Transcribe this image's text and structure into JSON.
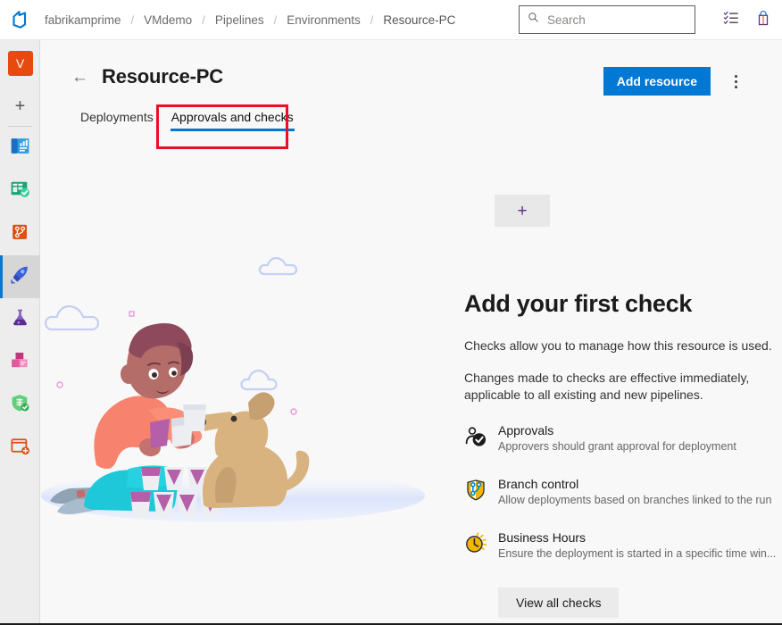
{
  "topbar": {
    "logo_icon": "azure-devops-logo",
    "breadcrumb": [
      "fabrikamprime",
      "VMdemo",
      "Pipelines",
      "Environments",
      "Resource-PC"
    ],
    "separator": "/",
    "search": {
      "placeholder": "Search",
      "icon": "search-icon",
      "value": ""
    },
    "icons": [
      {
        "name": "checklist-icon",
        "glyph": "checklist"
      },
      {
        "name": "shopping-bag-icon",
        "glyph": "bag"
      }
    ]
  },
  "rail": {
    "avatar_label": "V",
    "add_label": "+",
    "items": [
      {
        "name": "overview",
        "icon": "dashboard-icon"
      },
      {
        "name": "boards",
        "icon": "boards-icon"
      },
      {
        "name": "repos",
        "icon": "repos-icon"
      },
      {
        "name": "pipelines",
        "icon": "pipelines-rocket-icon",
        "active": true
      },
      {
        "name": "test-plans",
        "icon": "flask-icon"
      },
      {
        "name": "artifacts",
        "icon": "artifacts-boxes-icon"
      },
      {
        "name": "security",
        "icon": "shield-check-icon"
      },
      {
        "name": "add-extension",
        "icon": "add-card-icon"
      }
    ]
  },
  "page": {
    "back_icon": "back-arrow-icon",
    "title": "Resource-PC",
    "add_resource_label": "Add resource",
    "more_icon": "more-vertical-icon",
    "tabs": [
      {
        "label": "Deployments",
        "selected": false
      },
      {
        "label": "Approvals and checks",
        "selected": true
      }
    ],
    "add_check_plus": "+"
  },
  "panel": {
    "heading": "Add your first check",
    "paragraph1": "Checks allow you to manage how this resource is used.",
    "paragraph2": "Changes made to checks are effective immediately, applicable to all existing and new pipelines.",
    "checks": [
      {
        "icon": "approvals-person-check-icon",
        "title": "Approvals",
        "description": "Approvers should grant approval for deployment"
      },
      {
        "icon": "branch-control-shield-icon",
        "title": "Branch control",
        "description": "Allow deployments based on branches linked to the run"
      },
      {
        "icon": "business-hours-clock-icon",
        "title": "Business Hours",
        "description": "Ensure the deployment is started in a specific time win..."
      }
    ],
    "view_all_label": "View all checks"
  },
  "colors": {
    "accent_blue": "#0078d4",
    "highlight_red": "#e81123",
    "avatar_orange": "#e8490f",
    "rail_bg": "#ededed",
    "page_bg": "#f8f8f8"
  }
}
